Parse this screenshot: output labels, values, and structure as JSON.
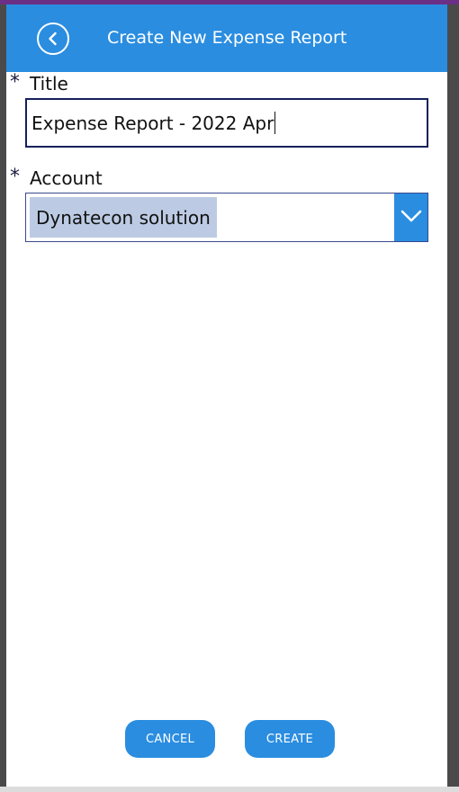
{
  "header": {
    "title": "Create New Expense Report"
  },
  "form": {
    "required_marker": "*",
    "title_field": {
      "label": "Title",
      "value": "Expense Report - 2022 Apr"
    },
    "account_field": {
      "label": "Account",
      "selected": "Dynatecon solution"
    }
  },
  "actions": {
    "cancel_label": "CANCEL",
    "create_label": "CREATE"
  },
  "icons": {
    "back": "back-arrow-circle-icon",
    "dropdown": "chevron-down-icon"
  },
  "colors": {
    "accent": "#2a8de0",
    "input_border": "#16205c",
    "selection": "#bccbe3"
  }
}
